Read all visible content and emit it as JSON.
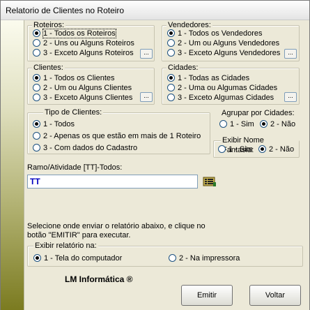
{
  "window": {
    "title": "Relatorio de Clientes no Roteiro"
  },
  "roteiros": {
    "legend": "Roteiros:",
    "options": [
      "1 - Todos os Roteiros",
      "2 - Uns ou Alguns Roteiros",
      "3 - Exceto Alguns Roteiros"
    ],
    "selected": 0,
    "browse_label": "..."
  },
  "vendedores": {
    "legend": "Vendedores:",
    "options": [
      "1 - Todos os Vendedores",
      "2 - Um ou Alguns Vendedores",
      "3 - Exceto Alguns Vendedores"
    ],
    "selected": 0,
    "browse_label": "..."
  },
  "clientes": {
    "legend": "Clientes:",
    "options": [
      "1 - Todos os Clientes",
      "2 - Um ou Alguns Clientes",
      "3 - Exceto Alguns Clientes"
    ],
    "selected": 0,
    "browse_label": "..."
  },
  "cidades": {
    "legend": "Cidades:",
    "options": [
      "1 - Todas as Cidades",
      "2 - Uma ou Algumas Cidades",
      "3 - Exceto Algumas Cidades"
    ],
    "selected": 0,
    "browse_label": "..."
  },
  "tipo_clientes": {
    "legend": "Tipo de Clientes:",
    "options": [
      "1 - Todos",
      "2 - Apenas os que estão em mais de 1 Roteiro",
      "3 - Com dados do Cadastro"
    ],
    "selected": 0
  },
  "agrupar": {
    "legend": "Agrupar por Cidades:",
    "options": [
      "1 - Sim",
      "2 - Não"
    ],
    "selected": 1
  },
  "nome_fantasia": {
    "legend": "Exibir Nome Fantasia:",
    "options": [
      "1 - Sim",
      "2 - Não"
    ],
    "selected": 1
  },
  "ramo": {
    "label": "Ramo/Atividade [TT]-Todos:",
    "value": "TT",
    "icon": "lookup-list-icon"
  },
  "instructions": {
    "line1": "Selecione onde enviar o relatório abaixo, e clique no",
    "line2": "botão \"EMITIR\" para executar."
  },
  "exibir": {
    "legend": "Exibir relatório na:",
    "options": [
      "1 - Tela do computador",
      "2 - Na impressora"
    ],
    "selected": 0
  },
  "footer": {
    "brand": "LM Informática ®",
    "emitir": "Emitir",
    "voltar": "Voltar"
  }
}
